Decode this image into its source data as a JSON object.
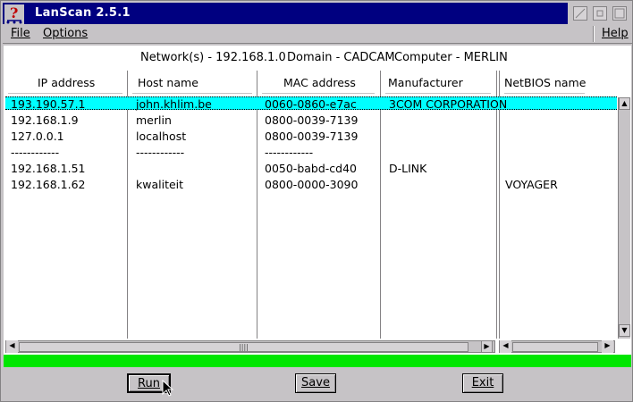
{
  "window": {
    "title": "LanScan 2.5.1",
    "icon": "question-mark-app-icon"
  },
  "menu": {
    "file_label": "File",
    "options_label": "Options",
    "help_label": "Help"
  },
  "info": {
    "network": "Network(s) - 192.168.1.0",
    "domain": "Domain - CADCAM",
    "computer": "Computer - MERLIN"
  },
  "table": {
    "headers": [
      "IP address",
      "Host name",
      "MAC address",
      "Manufacturer",
      "NetBIOS name"
    ],
    "rows": [
      {
        "ip": "193.190.57.1",
        "host": "john.khlim.be",
        "mac": "0060-0860-e7ac",
        "manufacturer": "3COM CORPORATION",
        "netbios": "",
        "selected": true
      },
      {
        "ip": "192.168.1.9",
        "host": "merlin",
        "mac": "0800-0039-7139",
        "manufacturer": "",
        "netbios": ""
      },
      {
        "ip": "127.0.0.1",
        "host": "localhost",
        "mac": "0800-0039-7139",
        "manufacturer": "",
        "netbios": ""
      },
      {
        "ip": "------------",
        "host": "------------",
        "mac": "------------",
        "manufacturer": "",
        "netbios": ""
      },
      {
        "ip": "192.168.1.51",
        "host": "",
        "mac": "0050-babd-cd40",
        "manufacturer": "D-LINK",
        "netbios": ""
      },
      {
        "ip": "192.168.1.62",
        "host": "kwaliteit",
        "mac": "0800-0000-3090",
        "manufacturer": "",
        "netbios": "VOYAGER"
      }
    ]
  },
  "status": {
    "color": "#00e600"
  },
  "buttons": {
    "run_label": "Run",
    "save_label": "Save",
    "exit_label": "Exit"
  },
  "colors": {
    "titlebar": "#000080",
    "selection": "#00ffff",
    "status": "#00e600"
  }
}
